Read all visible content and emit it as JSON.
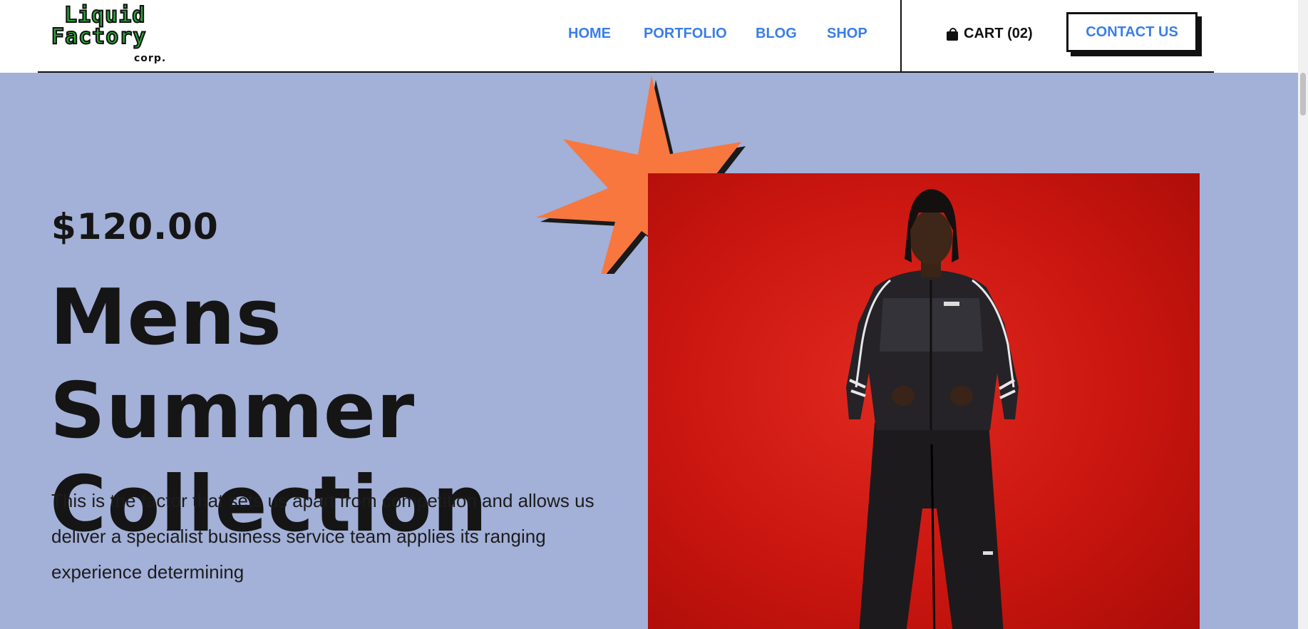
{
  "logo": {
    "line1": "Liquid",
    "line2": "Factory",
    "line3": "corp."
  },
  "nav": {
    "items": [
      {
        "label": "HOME"
      },
      {
        "label": "PORTFOLIO"
      },
      {
        "label": "BLOG"
      },
      {
        "label": "SHOP"
      }
    ]
  },
  "cart": {
    "label": "CART (02)",
    "icon": "shopping-bag-icon"
  },
  "contact": {
    "label": "CONTACT US"
  },
  "hero": {
    "price": "$120.00",
    "title_line1": "Mens Summer",
    "title_line2": "Collection",
    "description": "This is the factor that sets us apart from competition and allows us deliver a specialist business service team applies its ranging experience determining"
  },
  "colors": {
    "nav_link": "#3a7ee6",
    "hero_bg": "#a3b0d8",
    "star": "#f7773f",
    "photo_bg": "#c9150f"
  }
}
